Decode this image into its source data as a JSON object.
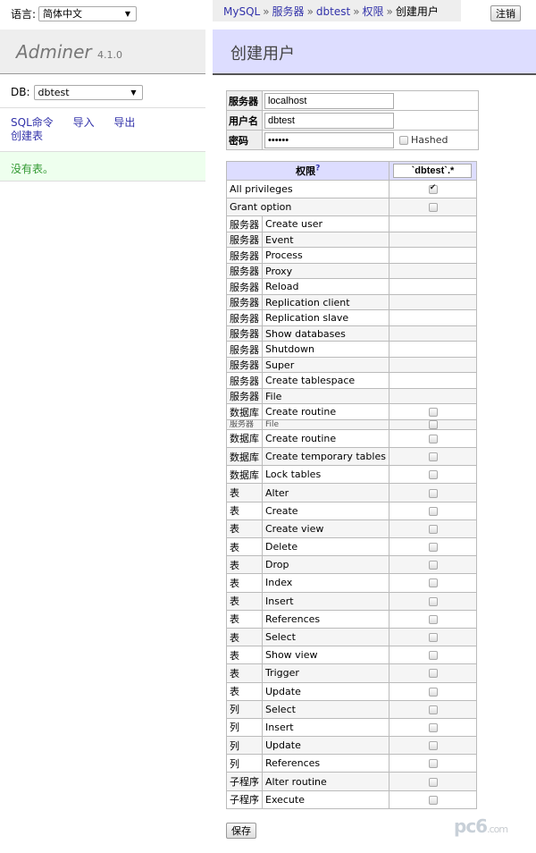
{
  "sidebar": {
    "language_label": "语言:",
    "language_value": "简体中文",
    "brand": "Adminer",
    "version": "4.1.0",
    "db_label": "DB:",
    "db_value": "dbtest",
    "links": {
      "sql_command": "SQL命令",
      "import": "导入",
      "export": "导出",
      "create_table": "创建表"
    },
    "no_tables": "没有表。"
  },
  "breadcrumb": {
    "items": [
      "MySQL",
      "服务器",
      "dbtest",
      "权限"
    ],
    "current": "创建用户",
    "separator": "»"
  },
  "logout_label": "注销",
  "page_title": "创建用户",
  "login_form": {
    "server_label": "服务器",
    "server_value": "localhost",
    "username_label": "用户名",
    "username_value": "dbtest",
    "password_label": "密码",
    "password_value": "••••••",
    "hashed_label": "Hashed",
    "hashed_checked": false
  },
  "privileges": {
    "header_label": "权限",
    "help_mark": "?",
    "scope_value": "`dbtest`.*",
    "rows": [
      {
        "cat": "",
        "name": "All privileges",
        "checkbox": true,
        "checked": true,
        "span": true
      },
      {
        "cat": "",
        "name": "Grant option",
        "checkbox": true,
        "checked": false,
        "span": true
      },
      {
        "cat": "服务器",
        "name": "Create user",
        "checkbox": false
      },
      {
        "cat": "服务器",
        "name": "Event",
        "checkbox": false
      },
      {
        "cat": "服务器",
        "name": "Process",
        "checkbox": false
      },
      {
        "cat": "服务器",
        "name": "Proxy",
        "checkbox": false
      },
      {
        "cat": "服务器",
        "name": "Reload",
        "checkbox": false
      },
      {
        "cat": "服务器",
        "name": "Replication client",
        "checkbox": false
      },
      {
        "cat": "服务器",
        "name": "Replication slave",
        "checkbox": false
      },
      {
        "cat": "服务器",
        "name": "Show databases",
        "checkbox": false
      },
      {
        "cat": "服务器",
        "name": "Shutdown",
        "checkbox": false
      },
      {
        "cat": "服务器",
        "name": "Super",
        "checkbox": false
      },
      {
        "cat": "服务器",
        "name": "Create tablespace",
        "checkbox": false
      },
      {
        "cat": "服务器",
        "name": "File",
        "checkbox": false
      },
      {
        "cat": "数据库",
        "name": "Create routine",
        "checkbox": true,
        "checked": false
      },
      {
        "cat": "服务器",
        "name": "File",
        "checkbox": true,
        "checked": false,
        "glitch": true
      },
      {
        "cat": "数据库",
        "name": "Create routine",
        "checkbox": true,
        "checked": false
      },
      {
        "cat": "数据库",
        "name": "Create temporary tables",
        "checkbox": true,
        "checked": false
      },
      {
        "cat": "数据库",
        "name": "Lock tables",
        "checkbox": true,
        "checked": false
      },
      {
        "cat": "表",
        "name": "Alter",
        "checkbox": true,
        "checked": false
      },
      {
        "cat": "表",
        "name": "Create",
        "checkbox": true,
        "checked": false
      },
      {
        "cat": "表",
        "name": "Create view",
        "checkbox": true,
        "checked": false
      },
      {
        "cat": "表",
        "name": "Delete",
        "checkbox": true,
        "checked": false
      },
      {
        "cat": "表",
        "name": "Drop",
        "checkbox": true,
        "checked": false
      },
      {
        "cat": "表",
        "name": "Index",
        "checkbox": true,
        "checked": false
      },
      {
        "cat": "表",
        "name": "Insert",
        "checkbox": true,
        "checked": false
      },
      {
        "cat": "表",
        "name": "References",
        "checkbox": true,
        "checked": false
      },
      {
        "cat": "表",
        "name": "Select",
        "checkbox": true,
        "checked": false
      },
      {
        "cat": "表",
        "name": "Show view",
        "checkbox": true,
        "checked": false
      },
      {
        "cat": "表",
        "name": "Trigger",
        "checkbox": true,
        "checked": false
      },
      {
        "cat": "表",
        "name": "Update",
        "checkbox": true,
        "checked": false
      },
      {
        "cat": "列",
        "name": "Select",
        "checkbox": true,
        "checked": false
      },
      {
        "cat": "列",
        "name": "Insert",
        "checkbox": true,
        "checked": false
      },
      {
        "cat": "列",
        "name": "Update",
        "checkbox": true,
        "checked": false
      },
      {
        "cat": "列",
        "name": "References",
        "checkbox": true,
        "checked": false
      },
      {
        "cat": "子程序",
        "name": "Alter routine",
        "checkbox": true,
        "checked": false
      },
      {
        "cat": "子程序",
        "name": "Execute",
        "checkbox": true,
        "checked": false
      }
    ]
  },
  "save_label": "保存",
  "watermark": {
    "main": "pc6",
    "sub": ".com"
  }
}
